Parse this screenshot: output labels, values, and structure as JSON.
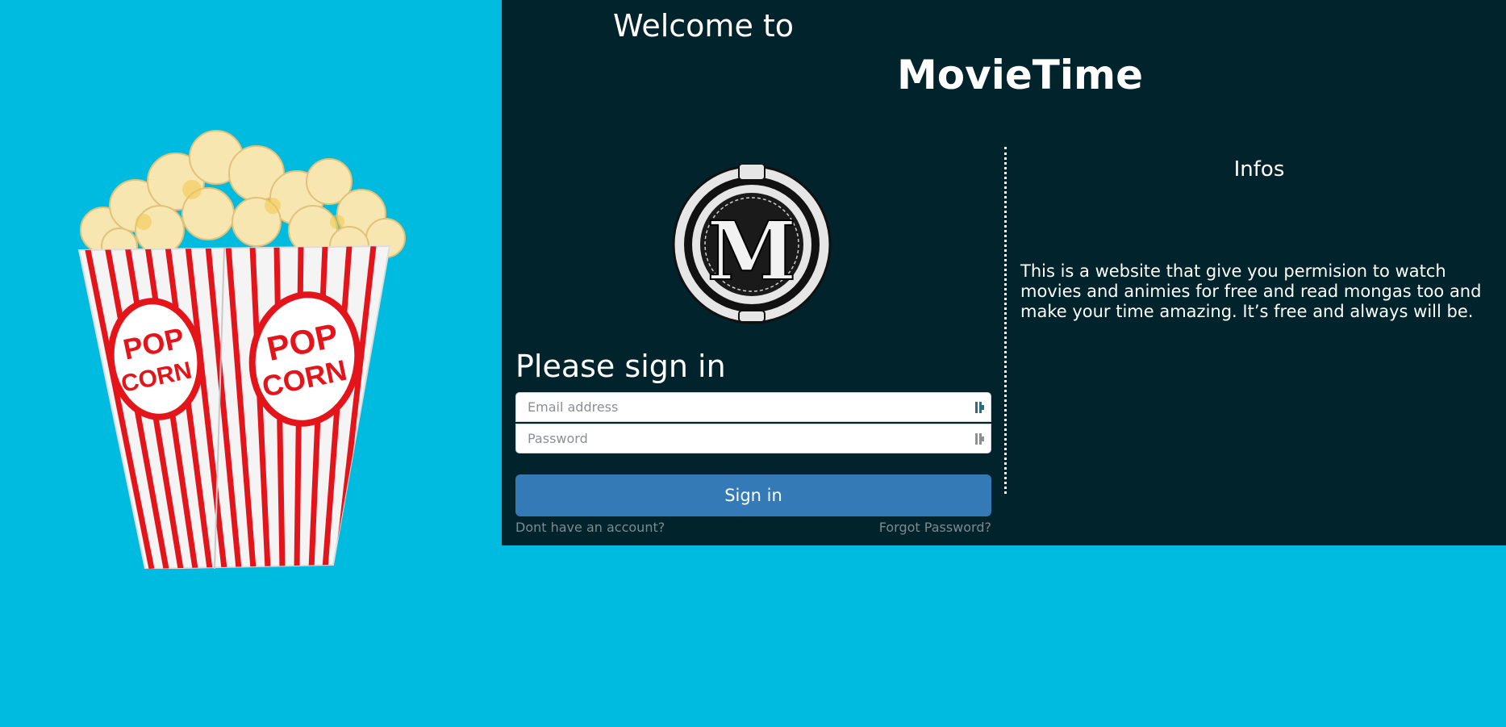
{
  "welcome": "Welcome to",
  "app_title": "MovieTime",
  "logo": {
    "letter": "M"
  },
  "popcorn": {
    "label_top": "POP",
    "label_bottom": "CORN"
  },
  "signin": {
    "heading": "Please sign in",
    "email_placeholder": "Email address",
    "password_placeholder": "Password",
    "button_label": "Sign in",
    "signup_link": "Dont have an account?",
    "forgot_link": "Forgot Password?"
  },
  "infos": {
    "title": "Infos",
    "text": "This is a website that give you permision to watch movies and animies for free and read mongas too and make your time amazing. It’s free and always will be."
  },
  "colors": {
    "background": "#00bbe0",
    "panel": "#00232c",
    "button": "#337ab7",
    "link": "#7d8a8f"
  },
  "icons": [
    "popcorn-image",
    "movietime-logo",
    "key-icon"
  ]
}
